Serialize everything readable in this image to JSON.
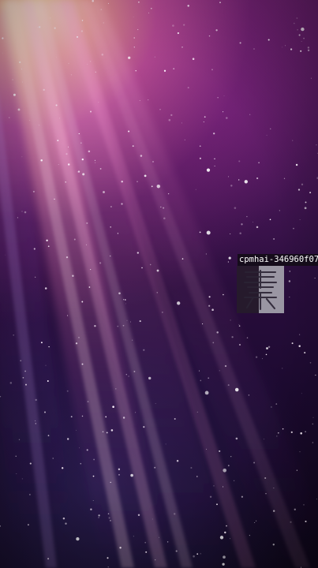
{
  "wallpaper": {
    "name": "galaxy-light-ray-wallpaper",
    "palette": {
      "highlight": "#ffe8aa",
      "pink": "#f26ab0",
      "magenta": "#b034b0",
      "violet": "#462c8a",
      "deep": "#14061e"
    }
  },
  "watermark": {
    "id_text": "cpmhai-346960f07",
    "logo_chars": "景象"
  }
}
